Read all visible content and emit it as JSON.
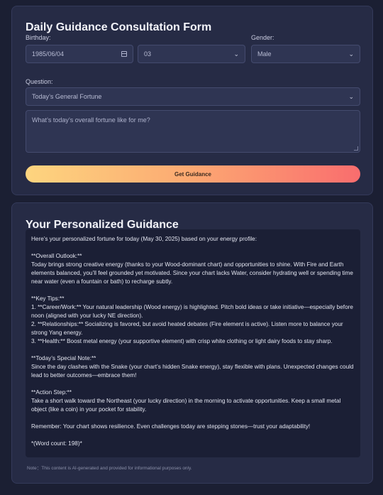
{
  "form": {
    "title": "Daily Guidance Consultation Form",
    "birthday_label": "Birthday:",
    "birthday_value": "1985/06/04",
    "hour_value": "03",
    "gender_label": "Gender:",
    "gender_value": "Male",
    "question_label": "Question:",
    "question_value": "Today’s General Fortune",
    "question_text": "What’s today’s overall fortune like for me?",
    "submit_label": "Get Guidance"
  },
  "result": {
    "title": "Your Personalized Guidance",
    "lines": [
      "Here’s your personalized fortune for today (May 30, 2025) based on your energy profile:",
      "",
      "**Overall Outlook:**",
      "Today brings strong creative energy (thanks to your Wood-dominant chart) and opportunities to shine. With Fire and Earth elements balanced, you’ll feel grounded yet motivated. Since your chart lacks Water, consider hydrating well or spending time near water (even a fountain or bath) to recharge subtly.",
      "",
      "**Key Tips:**",
      "1. **Career/Work:** Your natural leadership (Wood energy) is highlighted. Pitch bold ideas or take initiative—especially before noon (aligned with your lucky NE direction).",
      "2. **Relationships:** Socializing is favored, but avoid heated debates (Fire element is active). Listen more to balance your strong Yang energy.",
      "3. **Health:** Boost metal energy (your supportive element) with crisp white clothing or light dairy foods to stay sharp.",
      "",
      "**Today’s Special Note:**",
      "Since the day clashes with the Snake (your chart’s hidden Snake energy), stay flexible with plans. Unexpected changes could lead to better outcomes—embrace them!",
      "",
      "**Action Step:**",
      "Take a short walk toward the Northeast (your lucky direction) in the morning to activate opportunities. Keep a small metal object (like a coin) in your pocket for stability.",
      "",
      "Remember: Your chart shows resilience. Even challenges today are stepping stones—trust your adaptability!",
      "",
      "*(Word count: 198)*"
    ],
    "note": "Note：This content is AI-generated and provided for informational purposes only."
  }
}
